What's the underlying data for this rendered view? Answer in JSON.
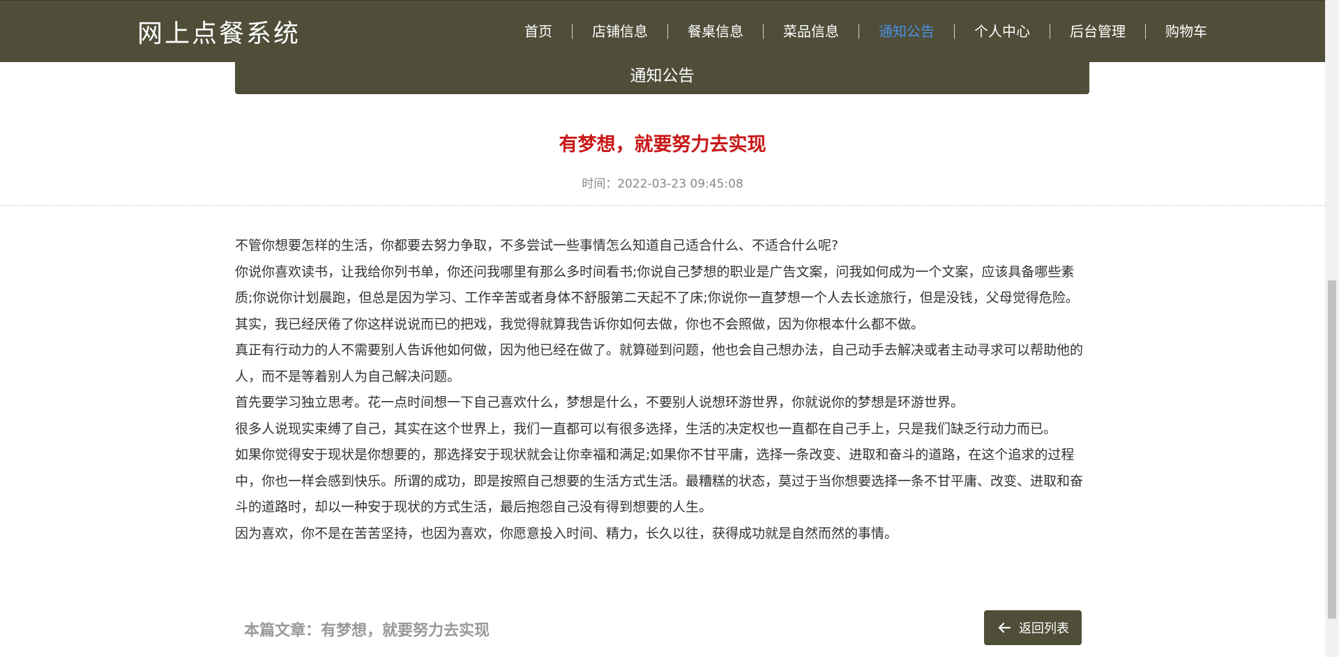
{
  "brand": {
    "title": "网上点餐系统"
  },
  "nav": {
    "items": [
      {
        "label": "首页"
      },
      {
        "label": "店铺信息"
      },
      {
        "label": "餐桌信息"
      },
      {
        "label": "菜品信息"
      },
      {
        "label": "通知公告"
      },
      {
        "label": "个人中心"
      },
      {
        "label": "后台管理"
      },
      {
        "label": "购物车"
      }
    ],
    "active_label": "通知公告",
    "active_color": "#4a90e2"
  },
  "section": {
    "title": "通知公告"
  },
  "article": {
    "title": "有梦想，就要努力去实现",
    "time": "时间：2022-03-23 09:45:08",
    "paragraphs": [
      "不管你想要怎样的生活，你都要去努力争取，不多尝试一些事情怎么知道自己适合什么、不适合什么呢?",
      "你说你喜欢读书，让我给你列书单，你还问我哪里有那么多时间看书;你说自己梦想的职业是广告文案，问我如何成为一个文案，应该具备哪些素质;你说你计划晨跑，但总是因为学习、工作辛苦或者身体不舒服第二天起不了床;你说你一直梦想一个人去长途旅行，但是没钱，父母觉得危险。其实，我已经厌倦了你这样说说而已的把戏，我觉得就算我告诉你如何去做，你也不会照做，因为你根本什么都不做。",
      "真正有行动力的人不需要别人告诉他如何做，因为他已经在做了。就算碰到问题，他也会自己想办法，自己动手去解决或者主动寻求可以帮助他的人，而不是等着别人为自己解决问题。",
      "首先要学习独立思考。花一点时间想一下自己喜欢什么，梦想是什么，不要别人说想环游世界，你就说你的梦想是环游世界。",
      "很多人说现实束缚了自己，其实在这个世界上，我们一直都可以有很多选择，生活的决定权也一直都在自己手上，只是我们缺乏行动力而已。",
      "如果你觉得安于现状是你想要的，那选择安于现状就会让你幸福和满足;如果你不甘平庸，选择一条改变、进取和奋斗的道路，在这个追求的过程中，你也一样会感到快乐。所谓的成功，即是按照自己想要的生活方式生活。最糟糕的状态，莫过于当你想要选择一条不甘平庸、改变、进取和奋斗的道路时，却以一种安于现状的方式生活，最后抱怨自己没有得到想要的人生。",
      "因为喜欢，你不是在苦苦坚持，也因为喜欢，你愿意投入时间、精力，长久以往，获得成功就是自然而然的事情。"
    ]
  },
  "footer": {
    "current_label": "本篇文章：有梦想，就要努力去实现",
    "back_label": "返回列表",
    "back_icon": "arrow-left-icon"
  },
  "colors": {
    "header_bg": "#4f4e39",
    "title_red": "#c81616"
  }
}
